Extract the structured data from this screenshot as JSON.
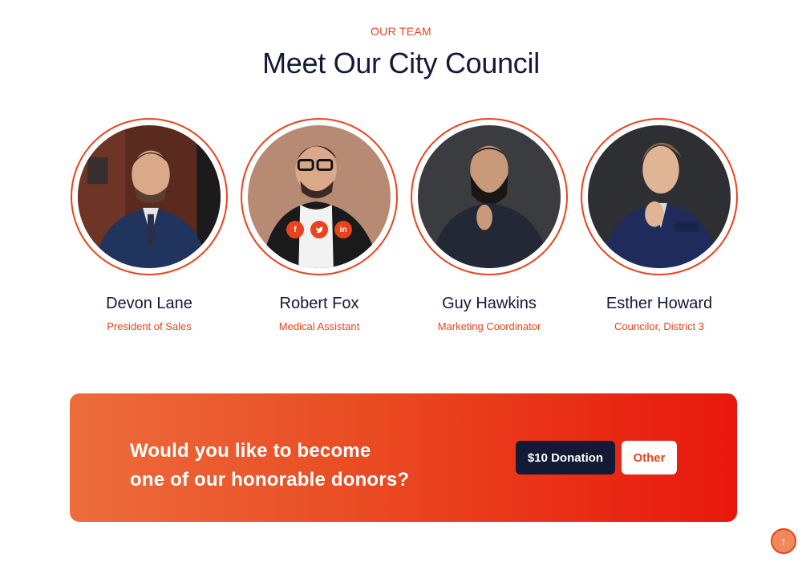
{
  "section": {
    "eyebrow": "OUR TEAM",
    "title": "Meet Our City Council"
  },
  "team": [
    {
      "name": "Devon Lane",
      "role": "President of Sales",
      "photo": "portrait-devon-lane"
    },
    {
      "name": "Robert Fox",
      "role": "Medical Assistant",
      "photo": "portrait-robert-fox",
      "socials": [
        {
          "icon": "facebook-icon",
          "glyph": "f"
        },
        {
          "icon": "twitter-icon",
          "glyph": "🐦"
        },
        {
          "icon": "linkedin-icon",
          "glyph": "in"
        }
      ]
    },
    {
      "name": "Guy Hawkins",
      "role": "Marketing Coordinator",
      "photo": "portrait-guy-hawkins"
    },
    {
      "name": "Esther Howard",
      "role": "Councilor, District 3",
      "photo": "portrait-esther-howard"
    }
  ],
  "cta": {
    "line1": "Would you like to become",
    "line2": "one of our honorable donors?",
    "donate_label": "$10 Donation",
    "other_label": "Other"
  },
  "back_to_top": {
    "icon": "arrow-up-icon",
    "glyph": "↑"
  },
  "colors": {
    "accent": "#e8431c",
    "navy": "#131a35",
    "gradient_start": "#ec6d3c",
    "gradient_end": "#e8170d"
  }
}
